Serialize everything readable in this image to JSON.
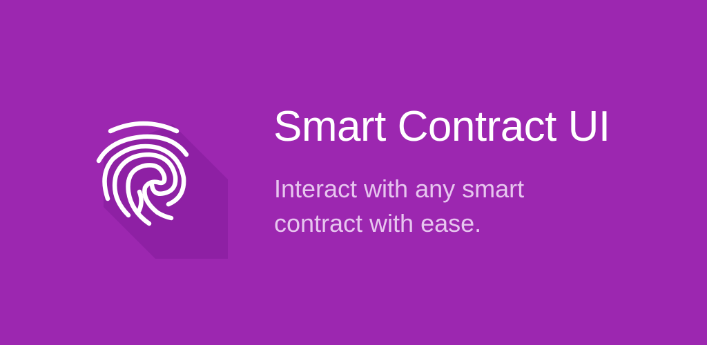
{
  "banner": {
    "background_color": "#9c27b0",
    "shadow_color": "#8a1fa0",
    "icon": "fingerprint-icon",
    "icon_color": "#ffffff",
    "title": "Smart Contract UI",
    "tagline_lines": [
      "Interact with any smart",
      "contract with ease."
    ],
    "title_color": "#ffffff",
    "tagline_color": "#e7c6ef"
  }
}
